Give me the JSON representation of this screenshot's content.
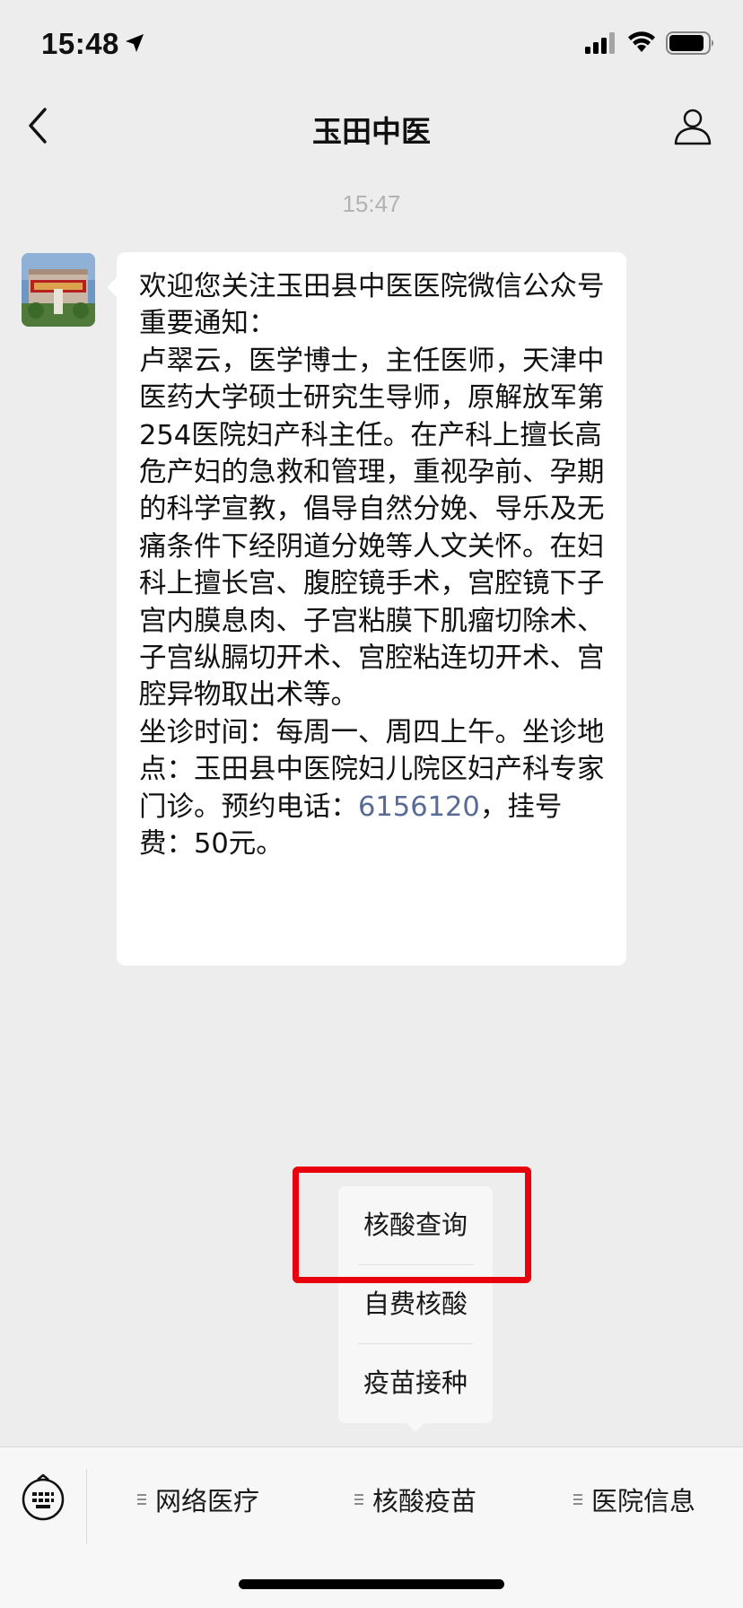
{
  "status_bar": {
    "time": "15:48",
    "icons": [
      "location-arrow-icon",
      "cellular-signal-icon",
      "wifi-icon",
      "battery-icon"
    ]
  },
  "nav": {
    "title": "玉田中医",
    "back_icon": "chevron-left-icon",
    "profile_icon": "person-icon"
  },
  "chat": {
    "timestamp": "15:47",
    "message": {
      "avatar_caption": "玉田中医",
      "text_before_phone": "欢迎您关注玉田县中医医院微信公众号\n重要通知：\n卢翠云，医学博士，主任医师，天津中医药大学硕士研究生导师，原解放军第254医院妇产科主任。在产科上擅长高危产妇的急救和管理，重视孕前、孕期的科学宣教，倡导自然分娩、导乐及无痛条件下经阴道分娩等人文关怀。在妇科上擅长宫、腹腔镜手术，宫腔镜下子宫内膜息肉、子宫粘膜下肌瘤切除术、子宫纵膈切开术、宫腔粘连切开术、宫腔异物取出术等。\n坐诊时间：每周一、周四上午。坐诊地点：玉田县中医院妇儿院区妇产科专家门诊。预约电话：",
      "phone": "6156120",
      "text_after_phone": "，挂号费：50元。"
    }
  },
  "popup_menu": {
    "items": [
      {
        "label": "核酸查询"
      },
      {
        "label": "自费核酸"
      },
      {
        "label": "疫苗接种"
      }
    ]
  },
  "menu_bar": {
    "keyboard_icon": "keyboard-icon",
    "tabs": [
      {
        "label": "网络医疗"
      },
      {
        "label": "核酸疫苗"
      },
      {
        "label": "医院信息"
      }
    ]
  },
  "colors": {
    "highlight": "#e8000d",
    "link": "#576b95",
    "background": "#ededed"
  }
}
